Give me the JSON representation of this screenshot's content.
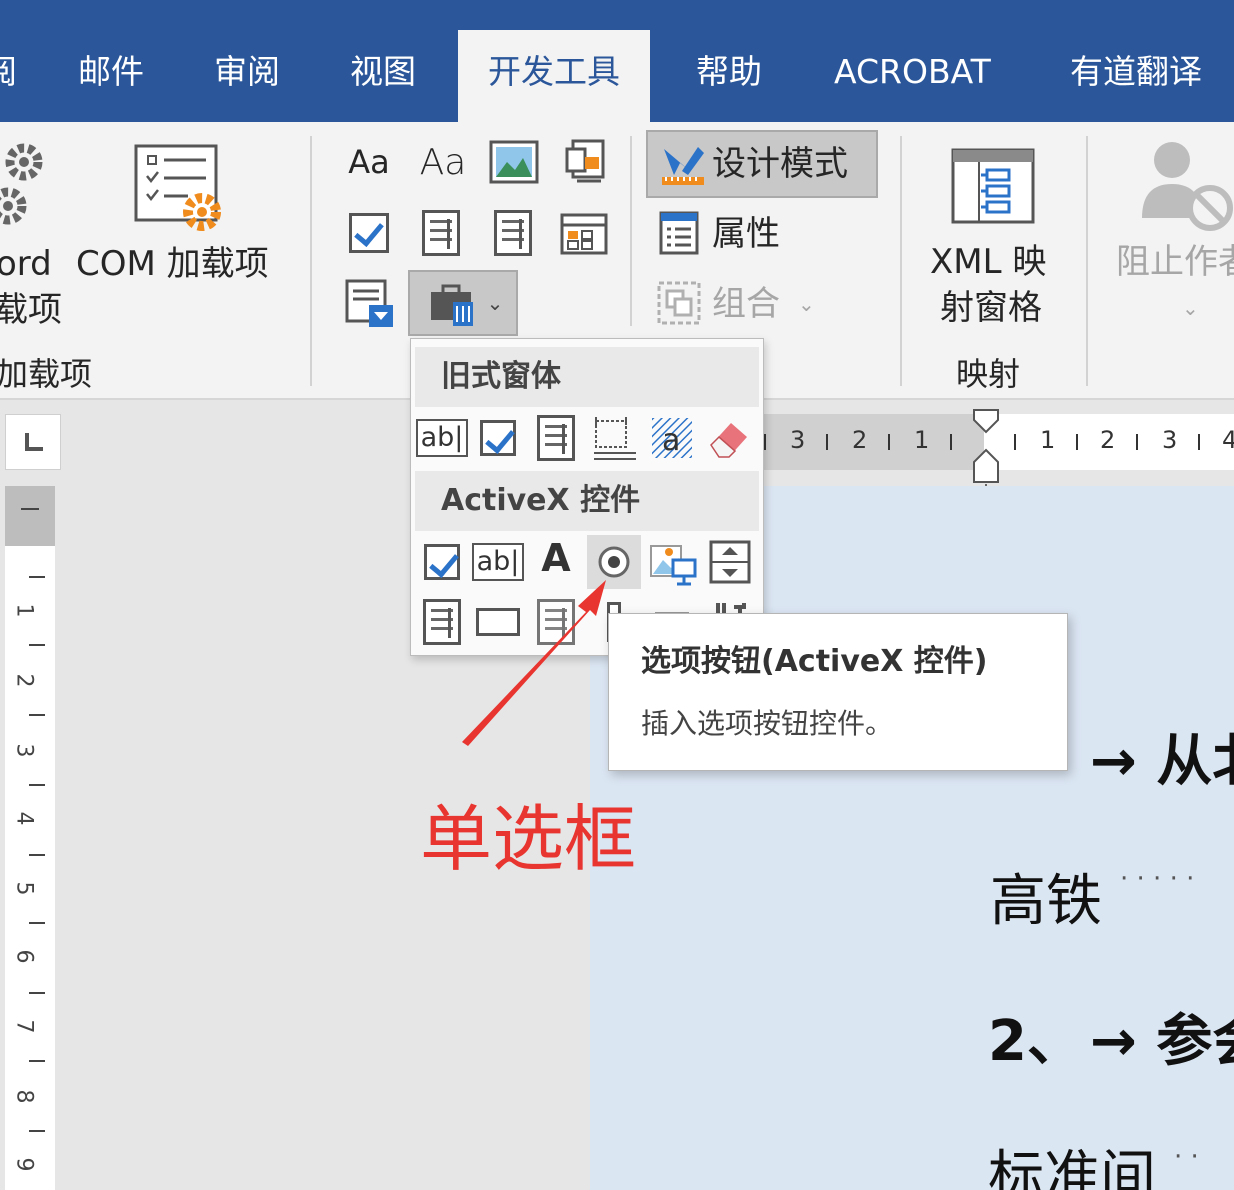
{
  "tabs": [
    {
      "label": "阅"
    },
    {
      "label": "邮件"
    },
    {
      "label": "审阅"
    },
    {
      "label": "视图"
    },
    {
      "label": "开发工具",
      "active": true
    },
    {
      "label": "帮助"
    },
    {
      "label": "ACROBAT"
    },
    {
      "label": "有道翻译"
    }
  ],
  "ribbon": {
    "addins": {
      "word_label_1": "ord",
      "word_label_2": "载项",
      "com_label": "COM 加载项",
      "group_label": "加载项"
    },
    "controls": {
      "design_mode": "设计模式",
      "properties": "属性",
      "group": "组合"
    },
    "mapping": {
      "xml_line1": "XML 映",
      "xml_line2": "射窗格",
      "group_label": "映射"
    },
    "protect": {
      "block_authors": "阻止作者"
    }
  },
  "dropdown": {
    "legacy_header": "旧式窗体",
    "activex_header": "ActiveX 控件",
    "legacy_text_field": "ab|",
    "activex_text_box": "ab|",
    "activex_label": "A"
  },
  "tooltip": {
    "title": "选项按钮(ActiveX 控件)",
    "description": "插入选项按钮控件。"
  },
  "annotation": {
    "label": "单选框",
    "color": "#e8352f"
  },
  "ruler": {
    "horizontal": [
      "3",
      "2",
      "1",
      "1",
      "2",
      "3",
      "4"
    ],
    "vertical": [
      "1",
      "2",
      "3",
      "4",
      "5",
      "6",
      "7",
      "8",
      "9"
    ]
  },
  "document": {
    "line1": "→ 从北",
    "line2": "高铁",
    "line2_dots": "· · · · ·",
    "line3_num": "2、",
    "line3": "→ 参会",
    "line4": "标准间",
    "line4_dots": "· ·"
  },
  "colors": {
    "tab_bar": "#2b579a",
    "ribbon": "#f3f3f3",
    "page": "#dbe6f3"
  }
}
